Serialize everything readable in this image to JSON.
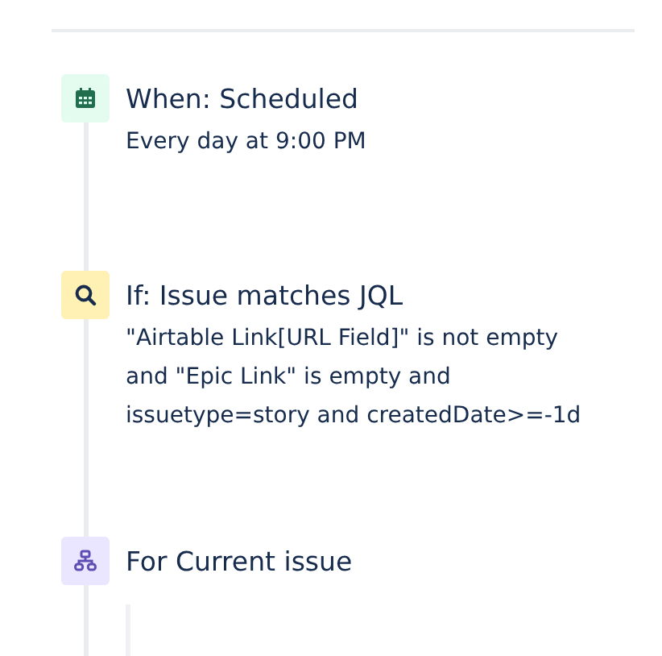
{
  "steps": [
    {
      "kind": "trigger",
      "title": "When: Scheduled",
      "description": [
        "Every day at 9:00 PM"
      ]
    },
    {
      "kind": "condition",
      "title": "If: Issue matches JQL",
      "description": [
        "\"Airtable Link[URL Field]\" is not empty",
        "and \"Epic Link\" is empty and",
        "issuetype=story and createdDate>=-1d"
      ]
    },
    {
      "kind": "branch",
      "title": "For Current issue"
    }
  ]
}
